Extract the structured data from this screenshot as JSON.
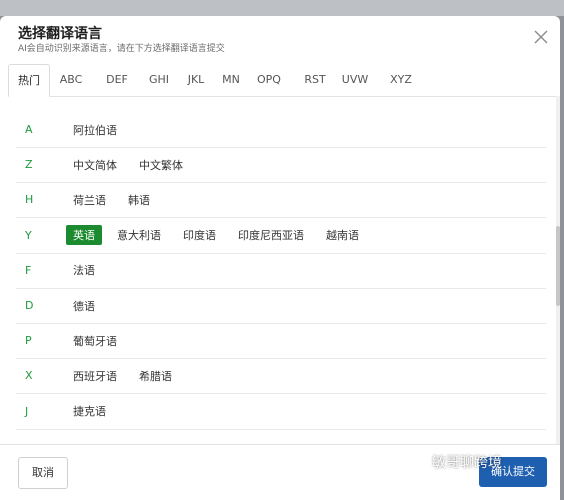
{
  "dialog": {
    "title": "选择翻译语言",
    "subtitle": "AI会自动识别来源语言，请在下方选择翻译语言提交"
  },
  "tabs": [
    "热门",
    "ABC",
    "DEF",
    "GHI",
    "JKL",
    "MN",
    "OPQ",
    "RST",
    "UVW",
    "XYZ"
  ],
  "active_tab": "热门",
  "rows": [
    {
      "letter": "A",
      "langs": [
        "阿拉伯语"
      ]
    },
    {
      "letter": "Z",
      "langs": [
        "中文简体",
        "中文繁体"
      ]
    },
    {
      "letter": "H",
      "langs": [
        "荷兰语",
        "韩语"
      ]
    },
    {
      "letter": "Y",
      "langs": [
        "英语",
        "意大利语",
        "印度语",
        "印度尼西亚语",
        "越南语"
      ]
    },
    {
      "letter": "F",
      "langs": [
        "法语"
      ]
    },
    {
      "letter": "D",
      "langs": [
        "德语"
      ]
    },
    {
      "letter": "P",
      "langs": [
        "葡萄牙语"
      ]
    },
    {
      "letter": "X",
      "langs": [
        "西班牙语",
        "希腊语"
      ]
    },
    {
      "letter": "J",
      "langs": [
        "捷克语"
      ]
    }
  ],
  "selected_language": "英语",
  "footer": {
    "cancel_label": "取消",
    "confirm_label": "确认提交"
  },
  "watermark": "敏哥聊跨境",
  "colors": {
    "accent_green": "#1c8a2e",
    "letter_green": "#1e9a3c",
    "primary_blue": "#1f5fb0"
  },
  "icons": {
    "close": "close-icon"
  }
}
